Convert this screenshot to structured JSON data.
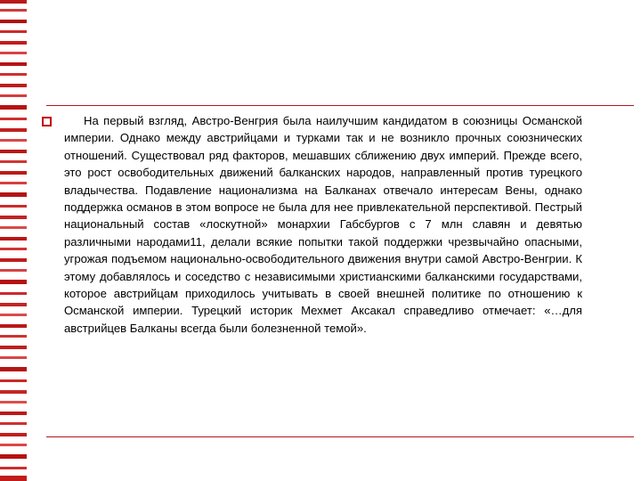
{
  "slide": {
    "bullet_marker": "square-outline-bullet",
    "accent_color": "#c00000",
    "rule_color": "#b01818",
    "background_color": "#ffffff",
    "text_color": "#000000",
    "body_paragraph": "На первый взгляд, Австро-Венгрия была наилучшим кандидатом в союзницы Османской империи. Однако между австрийцами и турками так и не возникло прочных союзнических отношений. Существовал ряд факторов, мешавших сближению двух империй. Прежде всего, это рост освободительных движений балканских народов, направленный против турецкого владычества. Подавление национализма на Балканах отвечало интересам Вены, однако поддержка османов в этом вопросе не была для нее привлекательной перспективой. Пестрый национальный состав «лоскутной» монархии Габсбургов с 7 млн славян и девятью различными народами11, делали всякие попытки такой поддержки чрезвычайно опасными, угрожая подъемом национально-освободительного движения внутри самой Австро-Венгрии. К этому добавлялось и соседство с независимыми христианскими балканскими государствами, которое австрийцам приходилось учитывать в своей внешней политике по отношению к Османской империи. Турецкий историк Мехмет Аксакал справедливо отмечает: «…для австрийцев Балканы всегда были болезненной темой»."
  }
}
